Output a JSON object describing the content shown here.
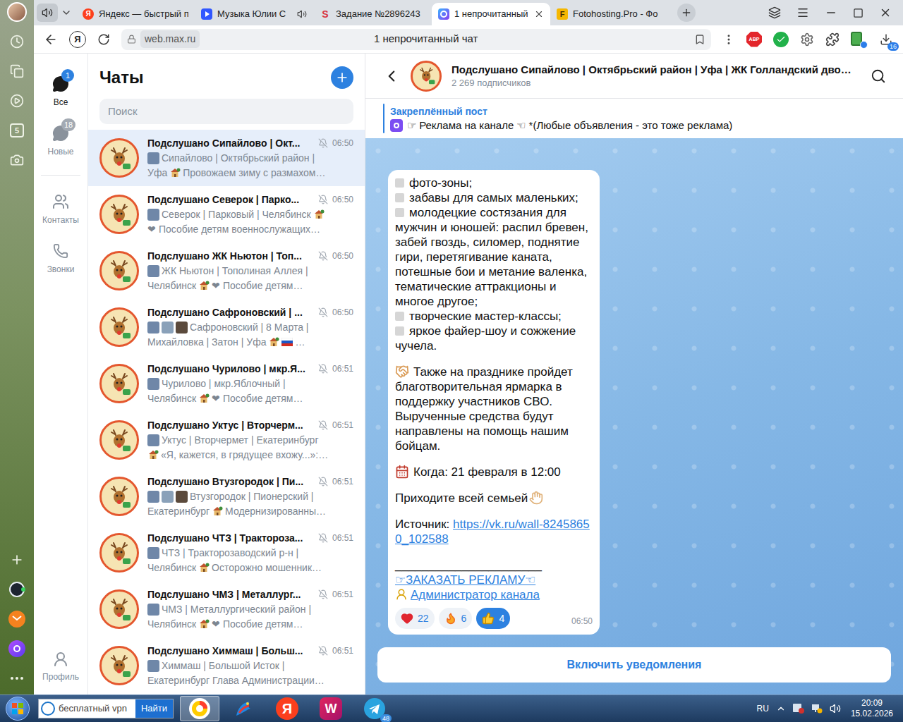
{
  "browser": {
    "sidebar": {
      "top": [
        {
          "kind": "avatar"
        },
        {
          "kind": "history"
        },
        {
          "kind": "collections"
        },
        {
          "kind": "media"
        },
        {
          "kind": "counter",
          "glyph": "5"
        },
        {
          "kind": "screenshot"
        }
      ],
      "bottom": [
        {
          "kind": "add"
        },
        {
          "kind": "assistant"
        },
        {
          "kind": "mail"
        },
        {
          "kind": "alice"
        },
        {
          "kind": "more"
        }
      ]
    },
    "tabs": [
      {
        "title": "Яндекс — быстрый п",
        "kind": "yandex",
        "glyph": "Я",
        "selected": false,
        "audio": false
      },
      {
        "title": "Музыка Юлии С",
        "kind": "music",
        "selected": false,
        "audio": true
      },
      {
        "title": "Задание №2896243",
        "kind": "letter-s",
        "glyph": "S",
        "selected": false,
        "audio": false
      },
      {
        "title": "1 непрочитанный",
        "kind": "max",
        "selected": true,
        "audio": false
      },
      {
        "title": "Fotohosting.Pro - Фо",
        "kind": "letter-f",
        "glyph": "F",
        "selected": false,
        "audio": false
      }
    ],
    "address": {
      "yandex": "Я",
      "site": "web.max.ru",
      "title": "1 непрочитанный чат",
      "abp": "ABP",
      "downloads_badge": "16"
    }
  },
  "app": {
    "nav": [
      {
        "label": "Все",
        "badge": "1",
        "kind": "chats",
        "selected": true
      },
      {
        "label": "Новые",
        "badge": "18",
        "kind": "new",
        "selected": false
      },
      {
        "label": "Контакты",
        "kind": "contacts",
        "selected": false
      },
      {
        "label": "Звонки",
        "kind": "calls",
        "selected": false
      }
    ],
    "profile": "Профиль",
    "chat_list": {
      "title": "Чаты",
      "search_placeholder": "Поиск",
      "chats": [
        {
          "title": "Подслушано Сипайлово | Окт...",
          "time": "06:50",
          "muted": true,
          "selected": true,
          "thumbs": 1,
          "lines": [
            [
              {
                "kind": "text",
                "text": "Сипайлово | Октябрьский район |"
              }
            ],
            [
              {
                "kind": "text",
                "text": "Уфа"
              },
              {
                "kind": "house"
              },
              {
                "kind": "text",
                "text": "Провожаем зиму с размахом…"
              }
            ]
          ]
        },
        {
          "title": "Подслушано Северок | Парко...",
          "time": "06:50",
          "muted": true,
          "selected": false,
          "thumbs": 1,
          "lines": [
            [
              {
                "kind": "text",
                "text": "Северок | Парковый | Челябинск"
              },
              {
                "kind": "house"
              }
            ],
            [
              {
                "kind": "text",
                "text": "❤ Пособие детям военнослужащих…"
              }
            ]
          ]
        },
        {
          "title": "Подслушано ЖК Ньютон | Топ...",
          "time": "06:50",
          "muted": true,
          "selected": false,
          "thumbs": 1,
          "lines": [
            [
              {
                "kind": "text",
                "text": "ЖК Ньютон | Тополиная Аллея |"
              }
            ],
            [
              {
                "kind": "text",
                "text": "Челябинск"
              },
              {
                "kind": "house"
              },
              {
                "kind": "text",
                "text": "❤ Пособие детям…"
              }
            ]
          ]
        },
        {
          "title": "Подслушано Сафроновский | ...",
          "time": "06:50",
          "muted": true,
          "selected": false,
          "thumbs": 3,
          "lines": [
            [
              {
                "kind": "text",
                "text": "Сафроновский | 8 Марта |"
              }
            ],
            [
              {
                "kind": "text",
                "text": "Михайловка | Затон | Уфа"
              },
              {
                "kind": "house"
              },
              {
                "kind": "flag"
              },
              {
                "kind": "text",
                "text": "…"
              }
            ]
          ]
        },
        {
          "title": "Подслушано Чурилово | мкр.Я...",
          "time": "06:51",
          "muted": true,
          "selected": false,
          "thumbs": 1,
          "lines": [
            [
              {
                "kind": "text",
                "text": "Чурилово | мкр.Яблочный |"
              }
            ],
            [
              {
                "kind": "text",
                "text": "Челябинск"
              },
              {
                "kind": "house"
              },
              {
                "kind": "text",
                "text": "❤ Пособие детям…"
              }
            ]
          ]
        },
        {
          "title": "Подслушано Уктус | Вторчерм...",
          "time": "06:51",
          "muted": true,
          "selected": false,
          "thumbs": 1,
          "lines": [
            [
              {
                "kind": "text",
                "text": "Уктус | Вторчермет | Екатеринбург"
              }
            ],
            [
              {
                "kind": "house"
              },
              {
                "kind": "text",
                "text": "«Я, кажется, в грядущее вхожу...»:…"
              }
            ]
          ]
        },
        {
          "title": "Подслушано Втузгородок | Пи...",
          "time": "06:51",
          "muted": true,
          "selected": false,
          "thumbs": 3,
          "lines": [
            [
              {
                "kind": "text",
                "text": "Втузгородок | Пионерский |"
              }
            ],
            [
              {
                "kind": "text",
                "text": "Екатеринбург"
              },
              {
                "kind": "house"
              },
              {
                "kind": "text",
                "text": "Модернизированны…"
              }
            ]
          ]
        },
        {
          "title": "Подслушано ЧТЗ | Трактороза...",
          "time": "06:51",
          "muted": true,
          "selected": false,
          "thumbs": 1,
          "lines": [
            [
              {
                "kind": "text",
                "text": "ЧТЗ | Тракторозаводский р-н |"
              }
            ],
            [
              {
                "kind": "text",
                "text": "Челябинск"
              },
              {
                "kind": "house"
              },
              {
                "kind": "text",
                "text": "Осторожно мошенник…"
              }
            ]
          ]
        },
        {
          "title": "Подслушано ЧМЗ | Металлург...",
          "time": "06:51",
          "muted": true,
          "selected": false,
          "thumbs": 1,
          "lines": [
            [
              {
                "kind": "text",
                "text": "ЧМЗ | Металлургический район |"
              }
            ],
            [
              {
                "kind": "text",
                "text": "Челябинск"
              },
              {
                "kind": "house"
              },
              {
                "kind": "text",
                "text": "❤ Пособие детям…"
              }
            ]
          ]
        },
        {
          "title": "Подслушано Химмаш | Больш...",
          "time": "06:51",
          "muted": true,
          "selected": false,
          "thumbs": 1,
          "lines": [
            [
              {
                "kind": "text",
                "text": "Химмаш | Большой Исток |"
              }
            ],
            [
              {
                "kind": "text",
                "text": "Екатеринбург Глава Администрации…"
              }
            ]
          ]
        }
      ]
    },
    "chat": {
      "title": "Подслушано Сипайлово | Октябрьский район | Уфа | ЖК Голландский дво…",
      "subscribers": "2 269 подписчиков",
      "pinned_label": "Закреплённый пост",
      "pinned_text": "☞ Реклама на канале ☜ *(Любые объявления - это тоже реклама)",
      "message": {
        "sections": [
          [
            {
              "kind": "bullet",
              "text": "фото-зоны;"
            },
            {
              "kind": "bullet",
              "text": "забавы для самых маленьких;"
            },
            {
              "kind": "bullet",
              "text": "молодецкие состязания для мужчин и юношей: распил бревен, забей гвоздь, силомер, поднятие гири, перетягивание каната, потешные бои и метание валенка, тематические аттракционы и многое другое;"
            },
            {
              "kind": "bullet",
              "text": "творческие мастер-классы;"
            },
            {
              "kind": "bullet",
              "text": "яркое файер-шоу и сожжение чучела."
            }
          ],
          [
            {
              "kind": "text",
              "icon": "handshake",
              "text": "Также на празднике пройдет благотворительная ярмарка в поддержку участников СВО. Вырученные средства будут направлены на помощь нашим бойцам."
            }
          ],
          [
            {
              "kind": "text",
              "icon": "calendar",
              "text": "Когда: 21 февраля в 12:00"
            }
          ],
          [
            {
              "kind": "text",
              "icon_after": "hands",
              "text": "Приходите всей семьей"
            }
          ],
          [
            {
              "kind": "source",
              "text": "Источник: ",
              "link": "https://vk.ru/wall-82458650_102588"
            }
          ],
          [
            {
              "kind": "text",
              "text": "______________________"
            },
            {
              "kind": "link",
              "text": "☞ЗАКАЗАТЬ РЕКЛАМУ☜"
            },
            {
              "kind": "link",
              "icon": "admin",
              "text": "Администратор канала"
            }
          ]
        ],
        "reactions": [
          {
            "kind": "heart",
            "count": "22",
            "selected": false
          },
          {
            "kind": "fire",
            "count": "6",
            "selected": false
          },
          {
            "kind": "thumbs",
            "count": "4",
            "selected": true
          }
        ],
        "time": "06:50"
      },
      "notify_button": "Включить уведомления"
    }
  },
  "taskbar": {
    "search": "бесплатный vpn",
    "search_button": "Найти",
    "apps": [
      {
        "kind": "ybrowser",
        "selected": true
      },
      {
        "kind": "bird",
        "selected": false
      },
      {
        "kind": "yandex",
        "glyph": "Я",
        "selected": false
      },
      {
        "kind": "wb",
        "glyph": "W",
        "selected": false
      },
      {
        "kind": "telegram",
        "badge": "48",
        "selected": false
      }
    ],
    "lang": "RU",
    "time": "20:09",
    "date": "15.02.2026"
  }
}
